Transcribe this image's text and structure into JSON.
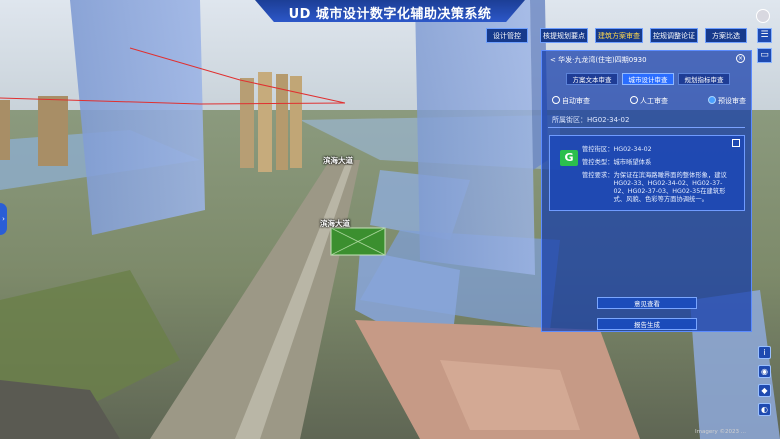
{
  "app": {
    "title": "UD 城市设计数字化辅助决策系统"
  },
  "nav": {
    "items": [
      {
        "label": "设计管控",
        "active": false
      },
      {
        "label": "核提规划要点",
        "active": false
      },
      {
        "label": "建筑方案审查",
        "active": true
      },
      {
        "label": "控规调整论证",
        "active": false
      },
      {
        "label": "方案比选",
        "active": false
      }
    ],
    "menu_icon": "list-icon",
    "layers_icon": "layers-icon"
  },
  "panel": {
    "breadcrumb": "< 华发·九龙湾(住宅)四期0930",
    "tabs": [
      {
        "label": "方案文本审查",
        "active": false
      },
      {
        "label": "城市设计审查",
        "active": true
      },
      {
        "label": "规划指标审查",
        "active": false
      }
    ],
    "radios": [
      {
        "label": "自动审查",
        "selected": false
      },
      {
        "label": "人工审查",
        "selected": false
      },
      {
        "label": "预设审查",
        "selected": true
      }
    ],
    "district_label": "所属街区：",
    "district_value": "HG02-34-02",
    "card": {
      "logo": "G",
      "rows": [
        {
          "k": "管控街区：",
          "v": "HG02-34-02"
        },
        {
          "k": "管控类型：",
          "v": "城市晰望体系"
        },
        {
          "k": "管控要求：",
          "v": "为保证在滨海路瞰界面的整体形象，建议HG02-33、HG02-34-02、HG02-37-02、HG02-37-03、HG02-35在建筑形式、风貌、色彩等方面协调统一。"
        }
      ]
    },
    "btn_opinion": "意见查看",
    "btn_report": "报告生成"
  },
  "scene": {
    "road_label_1": "滨海大道",
    "road_label_2": "滨海大道"
  },
  "footer": "Imagery ©2023 ..."
}
